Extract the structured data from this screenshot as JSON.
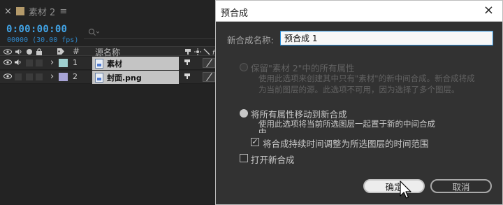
{
  "timeline": {
    "tab": {
      "close_glyph": "×",
      "title": "素材 2",
      "menu_glyph": "≡"
    },
    "timecode": "0:00:00:00",
    "fps": "00000 (30.00 fps)",
    "search_placeholder": "",
    "header": {
      "source_name": "源名称",
      "hash": "#"
    },
    "layers": [
      {
        "num": "1",
        "name": "素材",
        "color": "#9fcfcf"
      },
      {
        "num": "2",
        "name": "封面.png",
        "color": "#a7a4d6"
      }
    ]
  },
  "dialog": {
    "title": "预合成",
    "close_glyph": "×",
    "name_label": "新合成名称:",
    "name_value": "预合成 1",
    "option1": {
      "label": "保留\"素材 2\"中的所有属性",
      "desc_line1": "使用此选项来创建其中只有\"素材\"的新中间合成。新合成将成",
      "desc_line2": "为当前图层的源。此选项不可用，因为选择了多个图层。"
    },
    "option2": {
      "label": "将所有属性移动到新合成",
      "desc_line1": "使用此选项将当前所选图层一起置于新的中间合成",
      "desc_line2": "中"
    },
    "checkbox_adjust": {
      "label": "将合成持续时间调整为所选图层的时间范围",
      "checked": true
    },
    "checkbox_open": {
      "label": "打开新合成",
      "checked": false
    },
    "ok_label": "确定",
    "cancel_label": "取消"
  }
}
